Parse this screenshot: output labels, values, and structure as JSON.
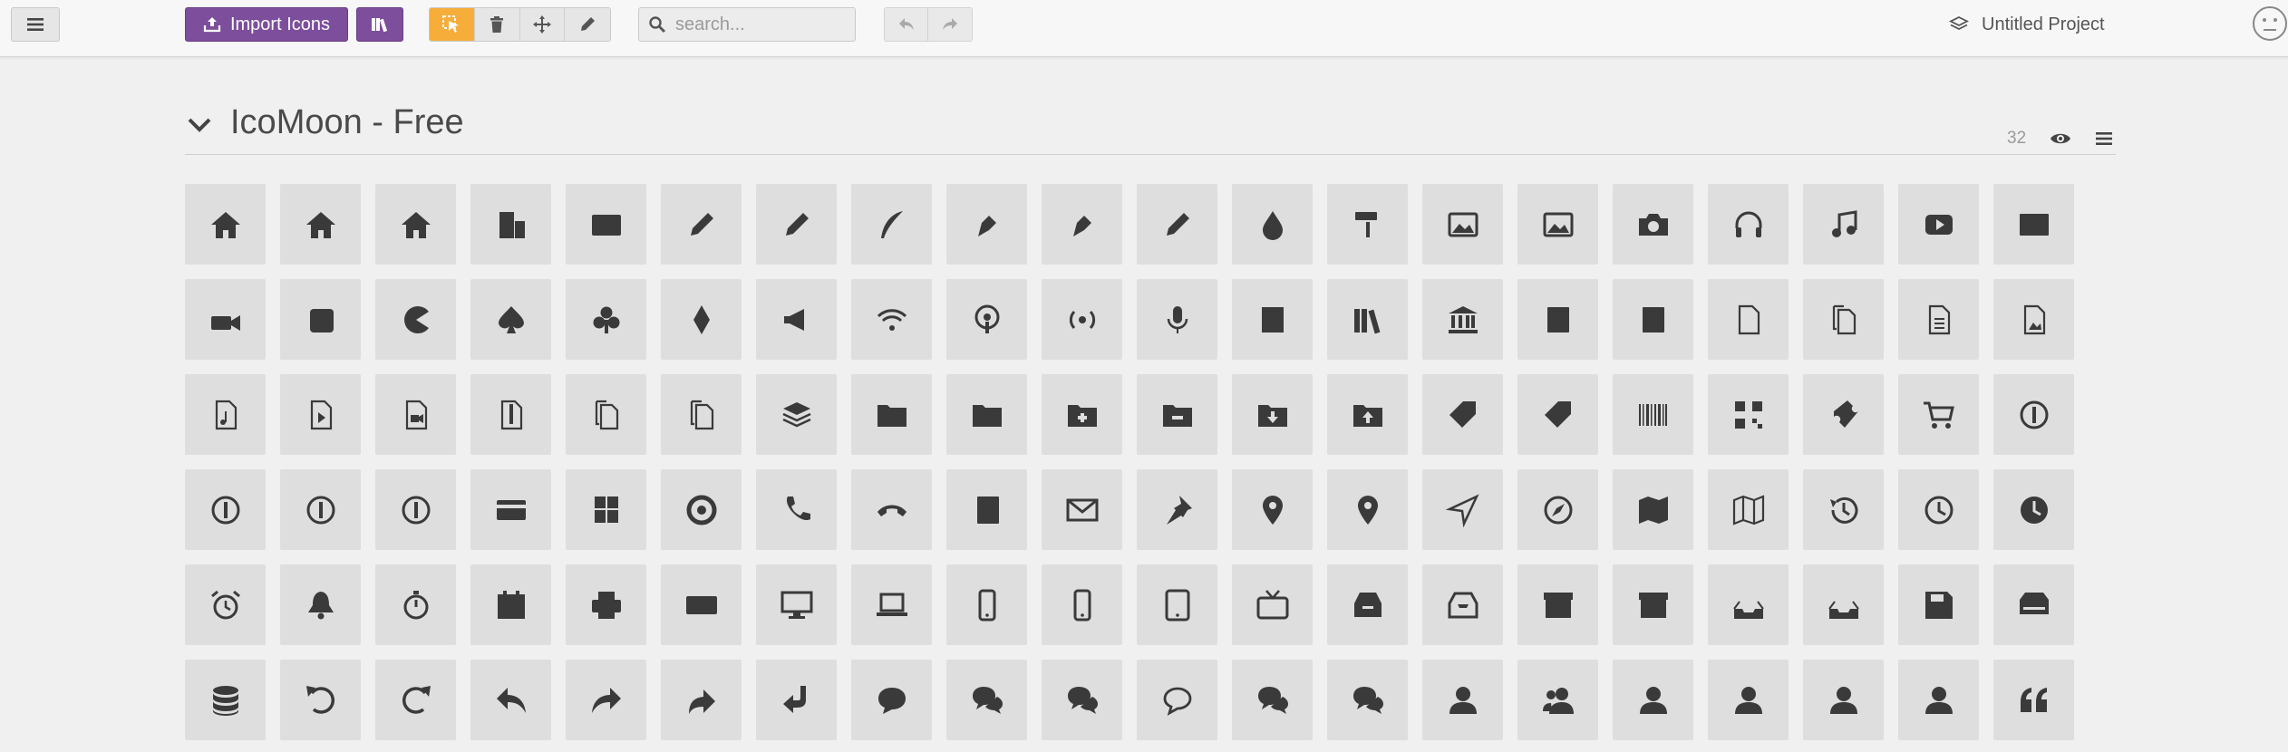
{
  "toolbar": {
    "import_label": "Import Icons",
    "search_placeholder": "search...",
    "project_name": "Untitled Project"
  },
  "set": {
    "title": "IcoMoon - Free",
    "count": "32"
  },
  "colors": {
    "accent_purple": "#7d4e9c",
    "active_tool": "#f6ad3a",
    "icon_tile": "#dedede",
    "icon_glyph": "#3a3a3a"
  },
  "icons": [
    "home",
    "home2",
    "home3",
    "office",
    "newspaper",
    "pencil",
    "pencil2",
    "quill",
    "pen",
    "blog",
    "eyedropper",
    "droplet",
    "paint-format",
    "image",
    "images",
    "camera",
    "headphones",
    "music",
    "play",
    "film",
    "video-camera",
    "dice",
    "pacman",
    "spades",
    "clubs",
    "diamonds",
    "bullhorn",
    "connection",
    "podcast",
    "feed",
    "mic",
    "book",
    "books",
    "library",
    "file-text",
    "profile",
    "file-empty",
    "files-empty",
    "file-text2",
    "file-picture",
    "file-music",
    "file-play",
    "file-video",
    "file-zip",
    "copy",
    "paste",
    "stack",
    "folder",
    "folder-open",
    "folder-plus",
    "folder-minus",
    "folder-download",
    "folder-upload",
    "price-tag",
    "price-tags",
    "barcode",
    "qrcode",
    "ticket",
    "cart",
    "coin-dollar",
    "coin-euro",
    "coin-pound",
    "coin-yen",
    "credit-card",
    "calculator",
    "lifebuoy",
    "phone",
    "phone-hang-up",
    "address-book",
    "envelop",
    "pushpin",
    "location",
    "location2",
    "compass",
    "compass2",
    "map",
    "map2",
    "history",
    "clock",
    "clock2",
    "alarm",
    "bell",
    "stopwatch",
    "calendar",
    "printer",
    "keyboard",
    "display",
    "laptop",
    "mobile",
    "mobile2",
    "tablet",
    "tv",
    "drawer",
    "drawer2",
    "box-add",
    "box-remove",
    "download",
    "upload",
    "floppy-disk",
    "drive",
    "database",
    "undo",
    "redo",
    "undo2",
    "redo2",
    "forward",
    "reply",
    "bubble",
    "bubbles",
    "bubbles2",
    "bubble2",
    "bubbles3",
    "bubbles4",
    "user",
    "users",
    "user-plus",
    "user-minus",
    "user-check",
    "user-tie",
    "quotes-left"
  ]
}
